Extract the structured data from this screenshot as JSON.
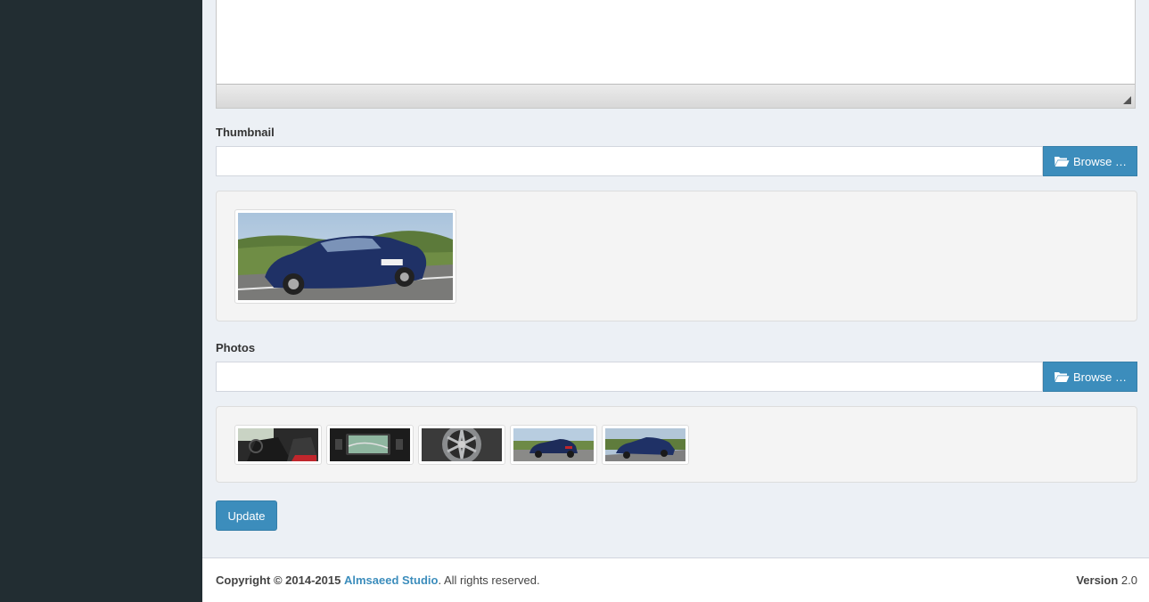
{
  "thumbnail": {
    "label": "Thumbnail",
    "input_value": "",
    "browse_label": "Browse …",
    "browse_icon": "folder-open-icon"
  },
  "photos": {
    "label": "Photos",
    "input_value": "",
    "browse_label": "Browse …",
    "browse_icon": "folder-open-icon",
    "items": [
      "car-interior-photo",
      "navigation-screen-photo",
      "alloy-wheel-photo",
      "car-rear-photo",
      "car-front-photo"
    ]
  },
  "update_label": "Update",
  "footer": {
    "copyright_prefix": "Copyright © 2014-2015",
    "studio_link": "Almsaeed Studio",
    "suffix": ". All rights reserved.",
    "version_label": "Version",
    "version_value": "2.0"
  },
  "colors": {
    "sidebar": "#222d32",
    "primary": "#3c8dbc",
    "page_bg": "#ecf0f5"
  }
}
